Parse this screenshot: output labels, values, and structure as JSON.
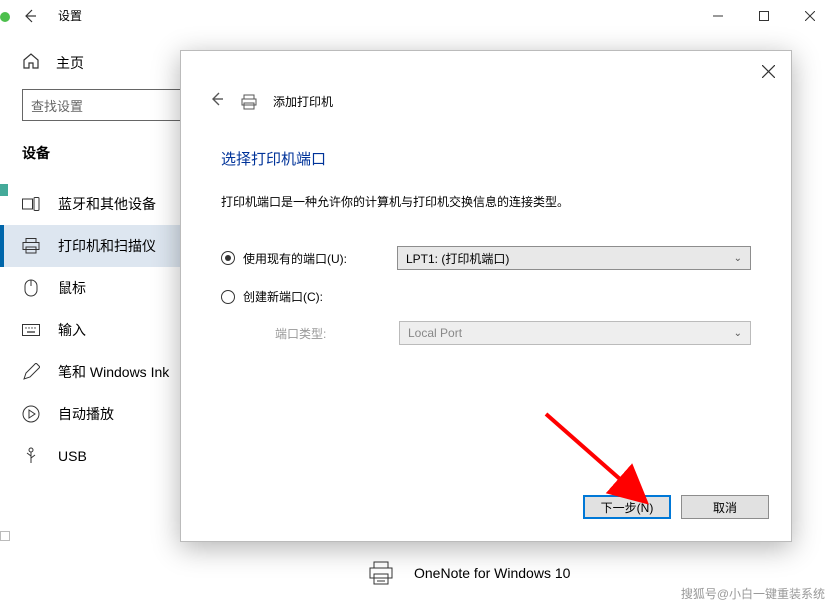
{
  "titlebar": {
    "title": "设置"
  },
  "sidebar": {
    "home": "主页",
    "search_placeholder": "查找设置",
    "category": "设备",
    "items": [
      {
        "label": "蓝牙和其他设备"
      },
      {
        "label": "打印机和扫描仪"
      },
      {
        "label": "鼠标"
      },
      {
        "label": "输入"
      },
      {
        "label": "笔和 Windows Ink"
      },
      {
        "label": "自动播放"
      },
      {
        "label": "USB"
      }
    ]
  },
  "behind": {
    "item": "OneNote for Windows 10"
  },
  "dialog": {
    "header": "添加打印机",
    "title": "选择打印机端口",
    "desc": "打印机端口是一种允许你的计算机与打印机交换信息的连接类型。",
    "radio_use_existing": "使用现有的端口(U):",
    "dropdown_existing": "LPT1: (打印机端口)",
    "radio_create_new": "创建新端口(C):",
    "port_type_label": "端口类型:",
    "dropdown_type": "Local Port",
    "btn_next": "下一步(N)",
    "btn_cancel": "取消"
  },
  "watermark": "搜狐号@小白一键重装系统"
}
